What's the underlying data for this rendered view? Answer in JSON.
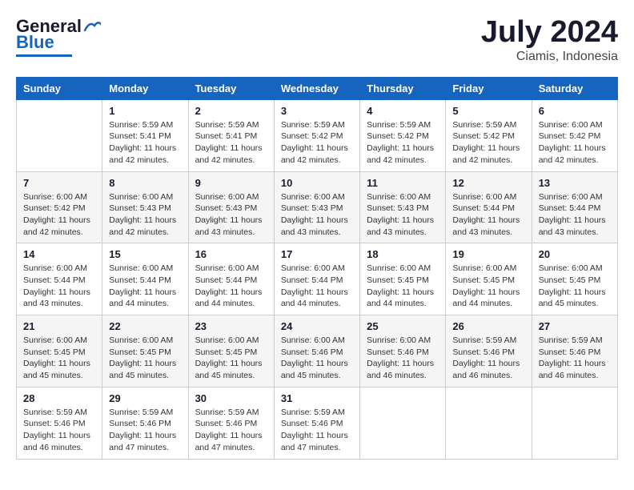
{
  "header": {
    "logo_general": "General",
    "logo_blue": "Blue",
    "main_title": "July 2024",
    "subtitle": "Ciamis, Indonesia"
  },
  "days_of_week": [
    "Sunday",
    "Monday",
    "Tuesday",
    "Wednesday",
    "Thursday",
    "Friday",
    "Saturday"
  ],
  "weeks": [
    [
      {
        "day": "",
        "info": ""
      },
      {
        "day": "1",
        "info": "Sunrise: 5:59 AM\nSunset: 5:41 PM\nDaylight: 11 hours\nand 42 minutes."
      },
      {
        "day": "2",
        "info": "Sunrise: 5:59 AM\nSunset: 5:41 PM\nDaylight: 11 hours\nand 42 minutes."
      },
      {
        "day": "3",
        "info": "Sunrise: 5:59 AM\nSunset: 5:42 PM\nDaylight: 11 hours\nand 42 minutes."
      },
      {
        "day": "4",
        "info": "Sunrise: 5:59 AM\nSunset: 5:42 PM\nDaylight: 11 hours\nand 42 minutes."
      },
      {
        "day": "5",
        "info": "Sunrise: 5:59 AM\nSunset: 5:42 PM\nDaylight: 11 hours\nand 42 minutes."
      },
      {
        "day": "6",
        "info": "Sunrise: 6:00 AM\nSunset: 5:42 PM\nDaylight: 11 hours\nand 42 minutes."
      }
    ],
    [
      {
        "day": "7",
        "info": "Sunrise: 6:00 AM\nSunset: 5:42 PM\nDaylight: 11 hours\nand 42 minutes."
      },
      {
        "day": "8",
        "info": "Sunrise: 6:00 AM\nSunset: 5:43 PM\nDaylight: 11 hours\nand 42 minutes."
      },
      {
        "day": "9",
        "info": "Sunrise: 6:00 AM\nSunset: 5:43 PM\nDaylight: 11 hours\nand 43 minutes."
      },
      {
        "day": "10",
        "info": "Sunrise: 6:00 AM\nSunset: 5:43 PM\nDaylight: 11 hours\nand 43 minutes."
      },
      {
        "day": "11",
        "info": "Sunrise: 6:00 AM\nSunset: 5:43 PM\nDaylight: 11 hours\nand 43 minutes."
      },
      {
        "day": "12",
        "info": "Sunrise: 6:00 AM\nSunset: 5:44 PM\nDaylight: 11 hours\nand 43 minutes."
      },
      {
        "day": "13",
        "info": "Sunrise: 6:00 AM\nSunset: 5:44 PM\nDaylight: 11 hours\nand 43 minutes."
      }
    ],
    [
      {
        "day": "14",
        "info": "Sunrise: 6:00 AM\nSunset: 5:44 PM\nDaylight: 11 hours\nand 43 minutes."
      },
      {
        "day": "15",
        "info": "Sunrise: 6:00 AM\nSunset: 5:44 PM\nDaylight: 11 hours\nand 44 minutes."
      },
      {
        "day": "16",
        "info": "Sunrise: 6:00 AM\nSunset: 5:44 PM\nDaylight: 11 hours\nand 44 minutes."
      },
      {
        "day": "17",
        "info": "Sunrise: 6:00 AM\nSunset: 5:44 PM\nDaylight: 11 hours\nand 44 minutes."
      },
      {
        "day": "18",
        "info": "Sunrise: 6:00 AM\nSunset: 5:45 PM\nDaylight: 11 hours\nand 44 minutes."
      },
      {
        "day": "19",
        "info": "Sunrise: 6:00 AM\nSunset: 5:45 PM\nDaylight: 11 hours\nand 44 minutes."
      },
      {
        "day": "20",
        "info": "Sunrise: 6:00 AM\nSunset: 5:45 PM\nDaylight: 11 hours\nand 45 minutes."
      }
    ],
    [
      {
        "day": "21",
        "info": "Sunrise: 6:00 AM\nSunset: 5:45 PM\nDaylight: 11 hours\nand 45 minutes."
      },
      {
        "day": "22",
        "info": "Sunrise: 6:00 AM\nSunset: 5:45 PM\nDaylight: 11 hours\nand 45 minutes."
      },
      {
        "day": "23",
        "info": "Sunrise: 6:00 AM\nSunset: 5:45 PM\nDaylight: 11 hours\nand 45 minutes."
      },
      {
        "day": "24",
        "info": "Sunrise: 6:00 AM\nSunset: 5:46 PM\nDaylight: 11 hours\nand 45 minutes."
      },
      {
        "day": "25",
        "info": "Sunrise: 6:00 AM\nSunset: 5:46 PM\nDaylight: 11 hours\nand 46 minutes."
      },
      {
        "day": "26",
        "info": "Sunrise: 5:59 AM\nSunset: 5:46 PM\nDaylight: 11 hours\nand 46 minutes."
      },
      {
        "day": "27",
        "info": "Sunrise: 5:59 AM\nSunset: 5:46 PM\nDaylight: 11 hours\nand 46 minutes."
      }
    ],
    [
      {
        "day": "28",
        "info": "Sunrise: 5:59 AM\nSunset: 5:46 PM\nDaylight: 11 hours\nand 46 minutes."
      },
      {
        "day": "29",
        "info": "Sunrise: 5:59 AM\nSunset: 5:46 PM\nDaylight: 11 hours\nand 47 minutes."
      },
      {
        "day": "30",
        "info": "Sunrise: 5:59 AM\nSunset: 5:46 PM\nDaylight: 11 hours\nand 47 minutes."
      },
      {
        "day": "31",
        "info": "Sunrise: 5:59 AM\nSunset: 5:46 PM\nDaylight: 11 hours\nand 47 minutes."
      },
      {
        "day": "",
        "info": ""
      },
      {
        "day": "",
        "info": ""
      },
      {
        "day": "",
        "info": ""
      }
    ]
  ]
}
